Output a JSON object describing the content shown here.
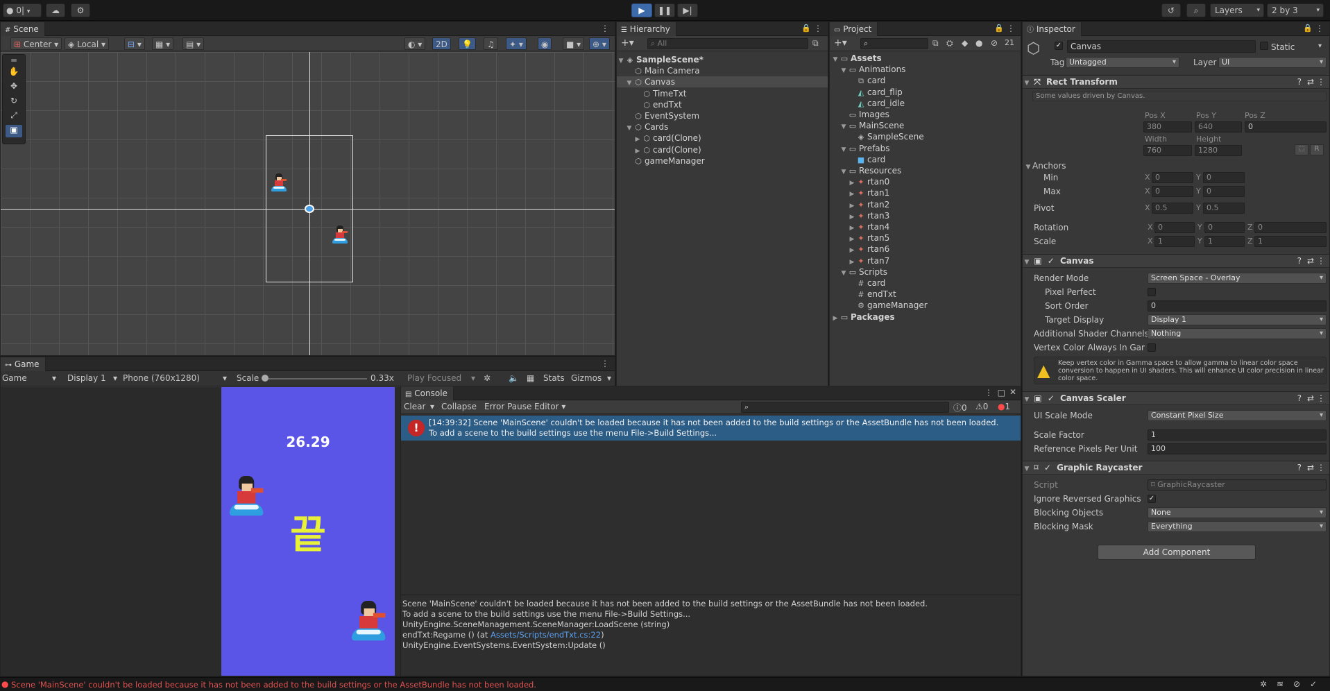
{
  "toolbar": {
    "account_label": "0|",
    "layers_label": "Layers",
    "layout_label": "2 by 3"
  },
  "scene": {
    "tab": "Scene",
    "pivot": "Center",
    "space": "Local",
    "mode_2d": "2D"
  },
  "game": {
    "tab": "Game",
    "view": "Game",
    "display": "Display 1",
    "resolution": "Phone (760x1280)",
    "scale_label": "Scale",
    "scale_value": "0.33x",
    "play_mode": "Play Focused",
    "stats": "Stats",
    "gizmos": "Gizmos",
    "timer_text": "26.29",
    "end_text": "끝",
    "bg_color": "#5a55e6"
  },
  "hierarchy": {
    "tab": "Hierarchy",
    "search_placeholder": "All",
    "items": [
      {
        "label": "SampleScene*",
        "indent": 0,
        "expand": "open",
        "icon": "scene",
        "bold": true
      },
      {
        "label": "Main Camera",
        "indent": 1,
        "expand": "none",
        "icon": "cube"
      },
      {
        "label": "Canvas",
        "indent": 1,
        "expand": "open",
        "icon": "cube",
        "selected": true
      },
      {
        "label": "TimeTxt",
        "indent": 2,
        "expand": "none",
        "icon": "cube"
      },
      {
        "label": "endTxt",
        "indent": 2,
        "expand": "none",
        "icon": "cube"
      },
      {
        "label": "EventSystem",
        "indent": 1,
        "expand": "none",
        "icon": "cube"
      },
      {
        "label": "Cards",
        "indent": 1,
        "expand": "open",
        "icon": "cube"
      },
      {
        "label": "card(Clone)",
        "indent": 2,
        "expand": "closed",
        "icon": "cube"
      },
      {
        "label": "card(Clone)",
        "indent": 2,
        "expand": "closed",
        "icon": "cube"
      },
      {
        "label": "gameManager",
        "indent": 1,
        "expand": "none",
        "icon": "cube"
      }
    ]
  },
  "project": {
    "tab": "Project",
    "hidden_count": "21",
    "items": [
      {
        "label": "Assets",
        "indent": 0,
        "expand": "open",
        "icon": "folder",
        "bold": true
      },
      {
        "label": "Animations",
        "indent": 1,
        "expand": "open",
        "icon": "folder"
      },
      {
        "label": "card",
        "indent": 2,
        "expand": "none",
        "icon": "anim"
      },
      {
        "label": "card_flip",
        "indent": 2,
        "expand": "none",
        "icon": "clip"
      },
      {
        "label": "card_idle",
        "indent": 2,
        "expand": "none",
        "icon": "clip"
      },
      {
        "label": "Images",
        "indent": 1,
        "expand": "none",
        "icon": "folder"
      },
      {
        "label": "MainScene",
        "indent": 1,
        "expand": "open",
        "icon": "folder"
      },
      {
        "label": "SampleScene",
        "indent": 2,
        "expand": "none",
        "icon": "scene"
      },
      {
        "label": "Prefabs",
        "indent": 1,
        "expand": "open",
        "icon": "folder"
      },
      {
        "label": "card",
        "indent": 2,
        "expand": "none",
        "icon": "prefab"
      },
      {
        "label": "Resources",
        "indent": 1,
        "expand": "open",
        "icon": "folder"
      },
      {
        "label": "rtan0",
        "indent": 2,
        "expand": "closed",
        "icon": "sprite"
      },
      {
        "label": "rtan1",
        "indent": 2,
        "expand": "closed",
        "icon": "sprite"
      },
      {
        "label": "rtan2",
        "indent": 2,
        "expand": "closed",
        "icon": "sprite"
      },
      {
        "label": "rtan3",
        "indent": 2,
        "expand": "closed",
        "icon": "sprite"
      },
      {
        "label": "rtan4",
        "indent": 2,
        "expand": "closed",
        "icon": "sprite"
      },
      {
        "label": "rtan5",
        "indent": 2,
        "expand": "closed",
        "icon": "sprite"
      },
      {
        "label": "rtan6",
        "indent": 2,
        "expand": "closed",
        "icon": "sprite"
      },
      {
        "label": "rtan7",
        "indent": 2,
        "expand": "closed",
        "icon": "sprite"
      },
      {
        "label": "Scripts",
        "indent": 1,
        "expand": "open",
        "icon": "folder"
      },
      {
        "label": "card",
        "indent": 2,
        "expand": "none",
        "icon": "script"
      },
      {
        "label": "endTxt",
        "indent": 2,
        "expand": "none",
        "icon": "script"
      },
      {
        "label": "gameManager",
        "indent": 2,
        "expand": "none",
        "icon": "gear"
      },
      {
        "label": "Packages",
        "indent": 0,
        "expand": "closed",
        "icon": "folder",
        "bold": true
      }
    ]
  },
  "console": {
    "tab": "Console",
    "clear": "Clear",
    "collapse": "Collapse",
    "error_pause": "Error Pause",
    "editor": "Editor",
    "log_count": "0",
    "warn_count": "0",
    "error_count": "1",
    "entry_line1": "[14:39:32] Scene 'MainScene' couldn't be loaded because it has not been added to the build settings or the AssetBundle has not been loaded.",
    "entry_line2": "To add a scene to the build settings use the menu File->Build Settings...",
    "detail_lines": [
      "Scene 'MainScene' couldn't be loaded because it has not been added to the build settings or the AssetBundle has not been loaded.",
      "To add a scene to the build settings use the menu File->Build Settings...",
      "UnityEngine.SceneManagement.SceneManager:LoadScene (string)"
    ],
    "detail_regame_prefix": "endTxt:Regame () (at ",
    "detail_regame_link": "Assets/Scripts/endTxt.cs:22",
    "detail_regame_suffix": ")",
    "detail_last": "UnityEngine.EventSystems.EventSystem:Update ()"
  },
  "status_bar": {
    "message": "Scene 'MainScene' couldn't be loaded because it has not been added to the build settings or the AssetBundle has not been loaded."
  },
  "inspector": {
    "tab": "Inspector",
    "object_name": "Canvas",
    "static_label": "Static",
    "tag_label": "Tag",
    "tag_value": "Untagged",
    "layer_label": "Layer",
    "layer_value": "UI",
    "rect": {
      "title": "Rect Transform",
      "note": "Some values driven by Canvas.",
      "posx_label": "Pos X",
      "posy_label": "Pos Y",
      "posz_label": "Pos Z",
      "posx": "380",
      "posy": "640",
      "posz": "0",
      "width_label": "Width",
      "height_label": "Height",
      "width": "760",
      "height": "1280",
      "r_button": "R",
      "anchors_label": "Anchors",
      "min_label": "Min",
      "max_label": "Max",
      "min_x": "0",
      "min_y": "0",
      "max_x": "0",
      "max_y": "0",
      "pivot_label": "Pivot",
      "pivot_x": "0.5",
      "pivot_y": "0.5",
      "rotation_label": "Rotation",
      "rot_x": "0",
      "rot_y": "0",
      "rot_z": "0",
      "scale_label": "Scale",
      "scale_x": "1",
      "scale_y": "1",
      "scale_z": "1",
      "x": "X",
      "y": "Y",
      "z": "Z"
    },
    "canvas": {
      "title": "Canvas",
      "render_mode_label": "Render Mode",
      "render_mode": "Screen Space - Overlay",
      "pixel_perfect_label": "Pixel Perfect",
      "sort_order_label": "Sort Order",
      "sort_order": "0",
      "target_display_label": "Target Display",
      "target_display": "Display 1",
      "shader_channels_label": "Additional Shader Channels",
      "shader_channels": "Nothing",
      "vertex_color_label": "Vertex Color Always In Gamr",
      "warning": "Keep vertex color in Gamma space to allow gamma to linear color space conversion to happen in UI shaders. This will enhance UI color precision in linear color space."
    },
    "scaler": {
      "title": "Canvas Scaler",
      "mode_label": "UI Scale Mode",
      "mode": "Constant Pixel Size",
      "factor_label": "Scale Factor",
      "factor": "1",
      "ppu_label": "Reference Pixels Per Unit",
      "ppu": "100"
    },
    "raycaster": {
      "title": "Graphic Raycaster",
      "script_label": "Script",
      "script": "GraphicRaycaster",
      "ignore_label": "Ignore Reversed Graphics",
      "blocking_objects_label": "Blocking Objects",
      "blocking_objects": "None",
      "blocking_mask_label": "Blocking Mask",
      "blocking_mask": "Everything"
    },
    "add_component": "Add Component"
  }
}
